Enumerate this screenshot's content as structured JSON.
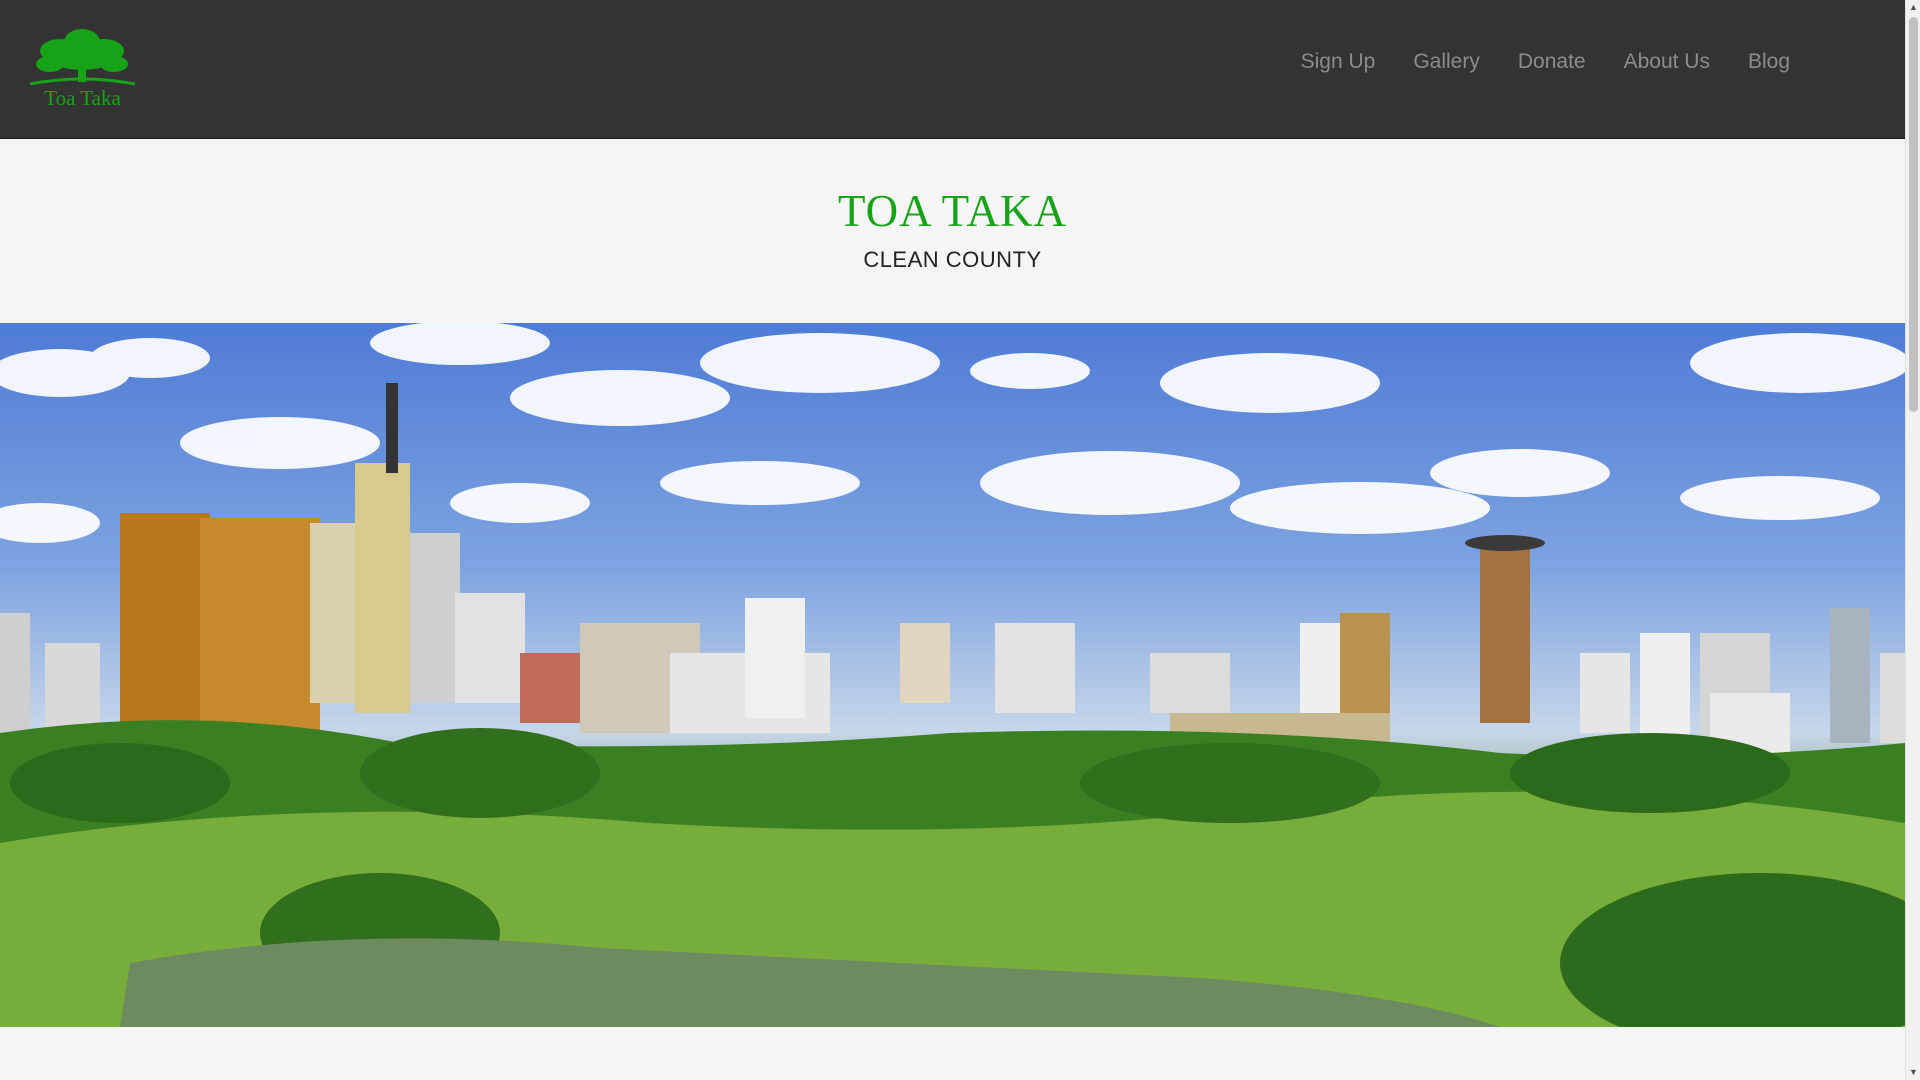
{
  "navbar": {
    "logo_text": "Toa Taka",
    "items": [
      "Sign Up",
      "Gallery",
      "Donate",
      "About Us",
      "Blog"
    ]
  },
  "header": {
    "title": "TOA TAKA",
    "subtitle": "CLEAN COUNTY"
  },
  "hero": {
    "icon": "city-skyline-image"
  },
  "colors": {
    "brand_green": "#17a317",
    "navbar_bg": "#333333",
    "nav_text": "#8c8c8c"
  },
  "scrollbar": {
    "up_icon": "arrow-up-icon",
    "down_icon": "arrow-down-icon"
  }
}
